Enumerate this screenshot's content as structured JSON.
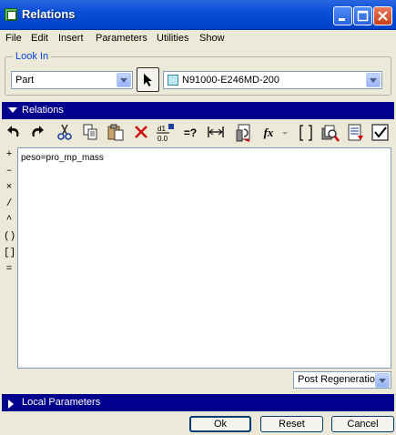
{
  "window": {
    "title": "Relations"
  },
  "menu": [
    "File",
    "Edit",
    "Insert",
    "Parameters",
    "Utilities",
    "Show"
  ],
  "lookin": {
    "label": "Look In",
    "type_value": "Part",
    "model_value": "N91000-E246MD-200"
  },
  "relations": {
    "header": "Relations",
    "operators": [
      "+",
      "–",
      "×",
      "/",
      "^",
      "()",
      "[]",
      "="
    ],
    "text": "peso=pro_mp_mass",
    "regen_value": "Post Regeneratior"
  },
  "local_params": {
    "header": "Local Parameters"
  },
  "buttons": {
    "ok": "Ok",
    "reset": "Reset",
    "cancel": "Cancel"
  },
  "toolbar": {
    "icons": [
      "undo-icon",
      "redo-icon",
      "cut-icon",
      "copy-icon",
      "paste-icon",
      "delete-icon",
      "units-icon",
      "evaluate-icon",
      "measure-icon",
      "insert-parameter-icon",
      "function-icon",
      "brackets-icon",
      "search-icon",
      "sort-icon",
      "verify-icon"
    ],
    "evaluate_label": "=?",
    "units_top": "d1",
    "units_bottom": "0.0",
    "function_label": "fx"
  },
  "colors": {
    "title_bar": "#0a4fd6",
    "section_bar": "#00008c",
    "window_bg": "#ece9d8",
    "delete_red": "#d01010"
  }
}
